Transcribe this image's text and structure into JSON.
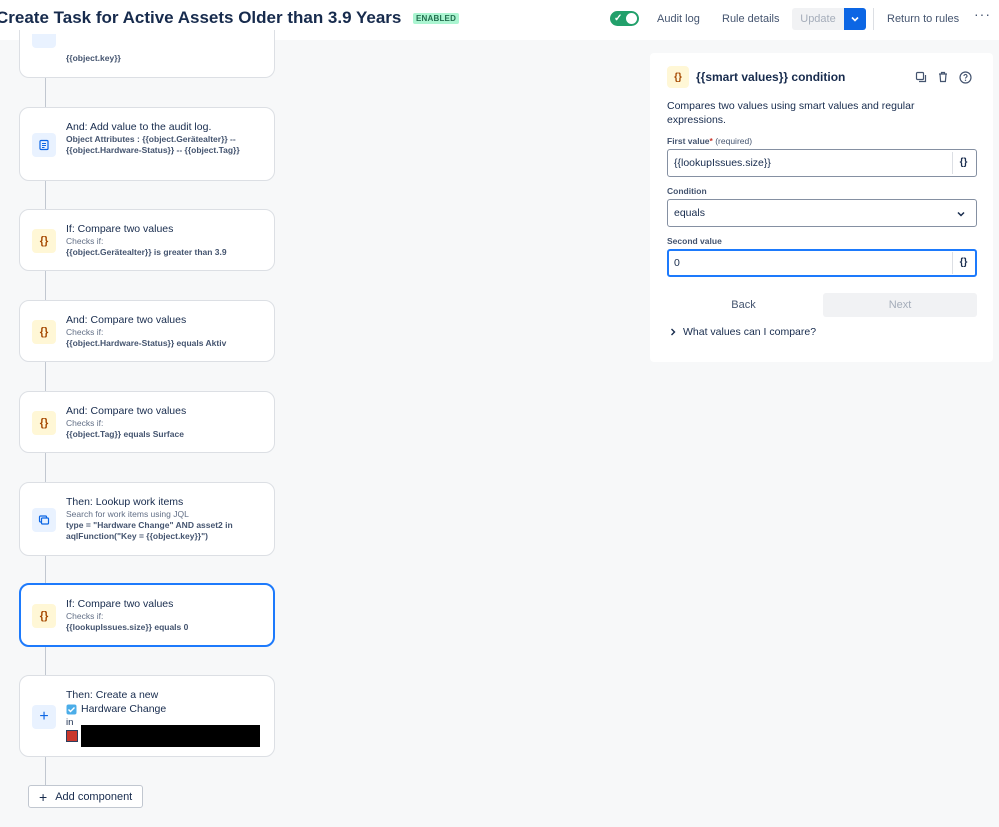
{
  "header": {
    "title": "Create Task for Active Assets Older than 3.9 Years",
    "status_badge": "ENABLED",
    "toggle_on": true,
    "audit_log": "Audit log",
    "rule_details": "Rule details",
    "update": "Update",
    "return_to_rules": "Return to rules",
    "more": "···"
  },
  "flow": {
    "partial_card": {
      "desc": "{{object.key}}"
    },
    "cards": [
      {
        "title": "And: Add value to the audit log.",
        "detail": "Object Attributes : {{object.Gerätealter}} -- {{object.Hardware-Status}} -- {{object.Tag}}",
        "icon": "audit-log-icon"
      },
      {
        "title": "If: Compare two values",
        "sub": "Checks if:",
        "detail": "{{object.Gerätealter}} is greater than 3.9",
        "icon": "smart-values-icon"
      },
      {
        "title": "And: Compare two values",
        "sub": "Checks if:",
        "detail": "{{object.Hardware-Status}} equals Aktiv",
        "icon": "smart-values-icon"
      },
      {
        "title": "And: Compare two values",
        "sub": "Checks if:",
        "detail": "{{object.Tag}} equals Surface",
        "icon": "smart-values-icon"
      },
      {
        "title": "Then: Lookup work items",
        "sub": "Search for work items using JQL",
        "detail": "type = \"Hardware Change\" AND asset2 in aqlFunction(\"Key = {{object.key}}\")",
        "icon": "lookup-icon"
      },
      {
        "title": "If: Compare two values",
        "sub": "Checks if:",
        "detail": "{{lookupIssues.size}} equals 0",
        "icon": "smart-values-icon",
        "selected": true
      },
      {
        "title": "Then: Create a new",
        "work_type": "Hardware Change",
        "in_label": "in",
        "icon": "plus-icon"
      }
    ],
    "add_component": "Add component"
  },
  "panel": {
    "title": "{{smart values}} condition",
    "description": "Compares two values using smart values and regular expressions.",
    "first_value_label": "First value",
    "required_mark": "*",
    "required_text": "(required)",
    "first_value": "{{lookupIssues.size}}",
    "condition_label": "Condition",
    "condition_value": "equals",
    "second_value_label": "Second value",
    "second_value": "0",
    "smart_value_glyph": "{}",
    "back": "Back",
    "next": "Next",
    "help_expand": "What values can I compare?"
  },
  "colors": {
    "accent": "#0c66e4",
    "enabled_badge_bg": "#abf5d1",
    "toggle_on": "#22a06b",
    "condition_icon_bg": "#fff7d6",
    "selected_border": "#1d7afc"
  }
}
